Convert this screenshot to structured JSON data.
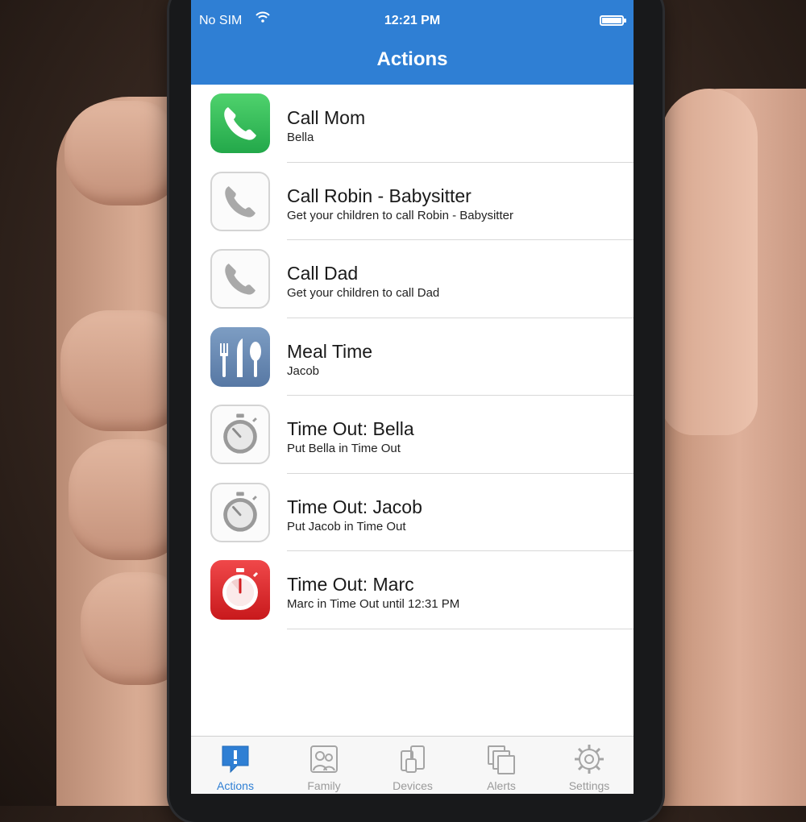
{
  "status_bar": {
    "carrier": "No SIM",
    "time": "12:21 PM",
    "wifi_icon": "wifi-icon",
    "battery_icon": "battery-icon"
  },
  "nav": {
    "title": "Actions"
  },
  "actions": [
    {
      "title": "Call Mom",
      "subtitle": "Bella",
      "icon": "phone-icon",
      "icon_style": "green"
    },
    {
      "title": "Call Robin - Babysitter",
      "subtitle": "Get your children to call Robin - Babysitter",
      "icon": "phone-icon",
      "icon_style": "grey"
    },
    {
      "title": "Call Dad",
      "subtitle": "Get your children to call Dad",
      "icon": "phone-icon",
      "icon_style": "grey"
    },
    {
      "title": "Meal Time",
      "subtitle": "Jacob",
      "icon": "utensils-icon",
      "icon_style": "blue"
    },
    {
      "title": "Time Out: Bella",
      "subtitle": "Put Bella in Time Out",
      "icon": "stopwatch-icon",
      "icon_style": "grey"
    },
    {
      "title": "Time Out: Jacob",
      "subtitle": "Put Jacob in Time Out",
      "icon": "stopwatch-icon",
      "icon_style": "grey"
    },
    {
      "title": "Time Out: Marc",
      "subtitle": "Marc in Time Out until 12:31 PM",
      "icon": "stopwatch-icon",
      "icon_style": "red"
    }
  ],
  "tabbar": {
    "tabs": [
      {
        "label": "Actions",
        "icon": "alert-bubble-icon",
        "active": true
      },
      {
        "label": "Family",
        "icon": "family-icon",
        "active": false
      },
      {
        "label": "Devices",
        "icon": "devices-icon",
        "active": false
      },
      {
        "label": "Alerts",
        "icon": "alerts-icon",
        "active": false
      },
      {
        "label": "Settings",
        "icon": "settings-gear-icon",
        "active": false
      }
    ]
  },
  "colors": {
    "accent": "#2f7fd4",
    "call_green": "#2fbf56",
    "timeout_red": "#e0292b",
    "meal_blue": "#6a8bb6",
    "inactive_grey": "#9a9a9a"
  }
}
